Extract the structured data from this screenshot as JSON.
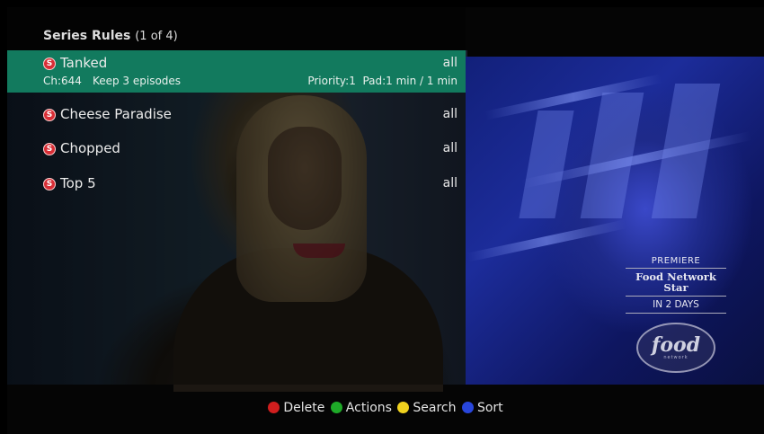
{
  "header": {
    "title": "Series Rules",
    "count": "(1 of 4)"
  },
  "rules": [
    {
      "icon": "S",
      "title": "Tanked",
      "value": "all",
      "channel": "Ch:644",
      "keep": "Keep 3 episodes",
      "meta": "Priority:1  Pad:1 min / 1 min"
    },
    {
      "icon": "S",
      "title": "Cheese Paradise",
      "value": "all"
    },
    {
      "icon": "S",
      "title": "Chopped",
      "value": "all"
    },
    {
      "icon": "S",
      "title": "Top 5",
      "value": "all"
    }
  ],
  "preview": {
    "promo_line1": "PREMIERE",
    "promo_line2": "Food Network Star",
    "promo_line3": "IN 2 DAYS",
    "logo": "food",
    "logo_sub": "network"
  },
  "footer": {
    "delete": {
      "label": "Delete",
      "color": "#d01e1e"
    },
    "actions": {
      "label": "Actions",
      "color": "#1eaa28"
    },
    "search": {
      "label": "Search",
      "color": "#f0d21e"
    },
    "sort": {
      "label": "Sort",
      "color": "#2846dc"
    }
  },
  "colors": {
    "selection": "#127a5e",
    "series_icon": "#d82e36"
  }
}
